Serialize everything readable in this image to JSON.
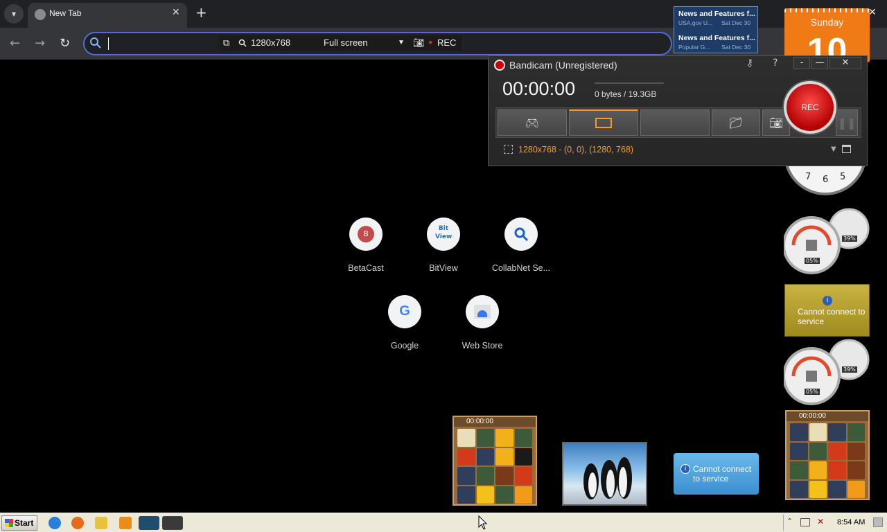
{
  "browser": {
    "tab_title": "New Tab",
    "tab_close": "✕",
    "new_tab": "+",
    "window_close": "✕",
    "nav": {
      "back": "←",
      "forward": "→",
      "reload": "↻"
    }
  },
  "recorder_bar": {
    "resolution": "1280x768",
    "mode": "Full screen",
    "rec_label": "REC"
  },
  "shortcuts": [
    {
      "label": "BetaCast",
      "icon": "B"
    },
    {
      "label": "BitView",
      "icon": "Bit View"
    },
    {
      "label": "CollabNet Se...",
      "icon": "search-icon"
    },
    {
      "label": "Google",
      "icon": "G"
    },
    {
      "label": "Web Store",
      "icon": "web-store-icon"
    }
  ],
  "news": {
    "items": [
      {
        "title": "News and Features f...",
        "source": "USA.gov U...",
        "date": "Sat Dec 30"
      },
      {
        "title": "News and Features f...",
        "source": "Popular G...",
        "date": "Sat Dec 30"
      }
    ]
  },
  "calendar": {
    "day": "Sunday",
    "date": "10"
  },
  "bandicam": {
    "title": "Bandicam (Unregistered)",
    "win_min": "-",
    "win_restore": "—",
    "win_close": "✕",
    "help": "?",
    "timer": "00:00:00",
    "bytes": "0 bytes / 19.3GB",
    "rec": "REC",
    "region": "1280x768 - (0, 0), (1280, 768)"
  },
  "clock_numbers": [
    "7",
    "6",
    "5"
  ],
  "gauges": [
    {
      "cpu": "05%",
      "mem": "39%"
    },
    {
      "cpu": "05%",
      "mem": "39%"
    }
  ],
  "connect_messages": {
    "gold": "Cannot connect to service",
    "blue": "Cannot connect to service"
  },
  "puzzles": [
    {
      "timer": "00:00:00"
    },
    {
      "timer": "00:00:00"
    }
  ],
  "taskbar": {
    "start": "Start",
    "time": "8:54 AM"
  }
}
